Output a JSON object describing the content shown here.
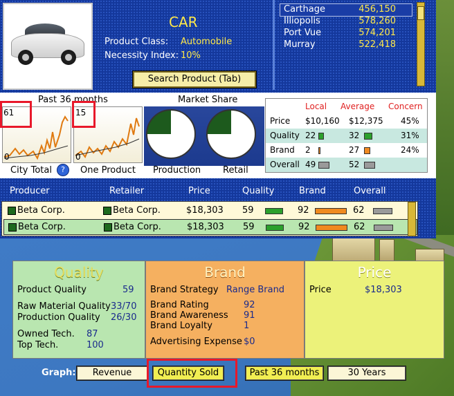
{
  "product": {
    "name": "CAR",
    "class_label": "Product Class:",
    "class_value": "Automobile",
    "necessity_label": "Necessity Index:",
    "necessity_value": "10%",
    "search_button": "Search Product (Tab)"
  },
  "cities": [
    {
      "name": "Carthage",
      "value": "456,150"
    },
    {
      "name": "Illiopolis",
      "value": "578,260"
    },
    {
      "name": "Port Vue",
      "value": "574,201"
    },
    {
      "name": "Murray",
      "value": "522,418"
    }
  ],
  "graphs": {
    "past_label": "Past 36 months",
    "market_share_label": "Market Share",
    "city_total_value": "61",
    "city_total_zero": "0",
    "city_total_label": "City Total",
    "one_product_value": "15",
    "one_product_zero": "0",
    "one_product_label": "One Product",
    "production_label": "Production",
    "retail_label": "Retail",
    "help_icon": "?"
  },
  "comparison": {
    "headers": [
      "Local",
      "Average",
      "Concern"
    ],
    "rows": [
      {
        "label": "Price",
        "local": "$10,160",
        "average": "$12,375",
        "concern": "45%"
      },
      {
        "label": "Quality",
        "local": "22",
        "average": "32",
        "concern": "31%"
      },
      {
        "label": "Brand",
        "local": "2",
        "average": "27",
        "concern": "24%"
      },
      {
        "label": "Overall",
        "local": "49",
        "average": "52",
        "concern": ""
      }
    ]
  },
  "producers": {
    "headers": [
      "Producer",
      "Retailer",
      "Price",
      "Quality",
      "Brand",
      "Overall"
    ],
    "rows": [
      {
        "producer": "Beta Corp.",
        "retailer": "Beta Corp.",
        "price": "$18,303",
        "quality": "59",
        "brand": "92",
        "overall": "62"
      },
      {
        "producer": "Beta Corp.",
        "retailer": "Beta Corp.",
        "price": "$18,303",
        "quality": "59",
        "brand": "92",
        "overall": "62"
      }
    ]
  },
  "quality_panel": {
    "title": "Quality",
    "product_quality_label": "Product Quality",
    "product_quality": "59",
    "raw_material_label": "Raw Material Quality",
    "raw_material": "33/70",
    "production_quality_label": "Production Quality",
    "production_quality": "26/30",
    "owned_tech_label": "Owned Tech.",
    "owned_tech": "87",
    "top_tech_label": "Top Tech.",
    "top_tech": "100"
  },
  "brand_panel": {
    "title": "Brand",
    "strategy_label": "Brand Strategy",
    "strategy": "Range Brand",
    "rating_label": "Brand Rating",
    "rating": "92",
    "awareness_label": "Brand Awareness",
    "awareness": "91",
    "loyalty_label": "Brand Loyalty",
    "loyalty": "1",
    "advertising_label": "Advertising Expense",
    "advertising": "$0"
  },
  "price_panel": {
    "title": "Price",
    "price_label": "Price",
    "price": "$18,303"
  },
  "graph_controls": {
    "label": "Graph:",
    "revenue": "Revenue",
    "quantity_sold": "Quantity Sold",
    "past_36": "Past 36 months",
    "years_30": "30 Years"
  },
  "colors": {
    "panel_blue": "#14389c",
    "accent_yellow": "#ffe94a",
    "highlight_red": "#e8182a",
    "quality_green": "#b9e6b0",
    "brand_orange": "#f5b060",
    "price_yellow": "#ecf27a"
  }
}
